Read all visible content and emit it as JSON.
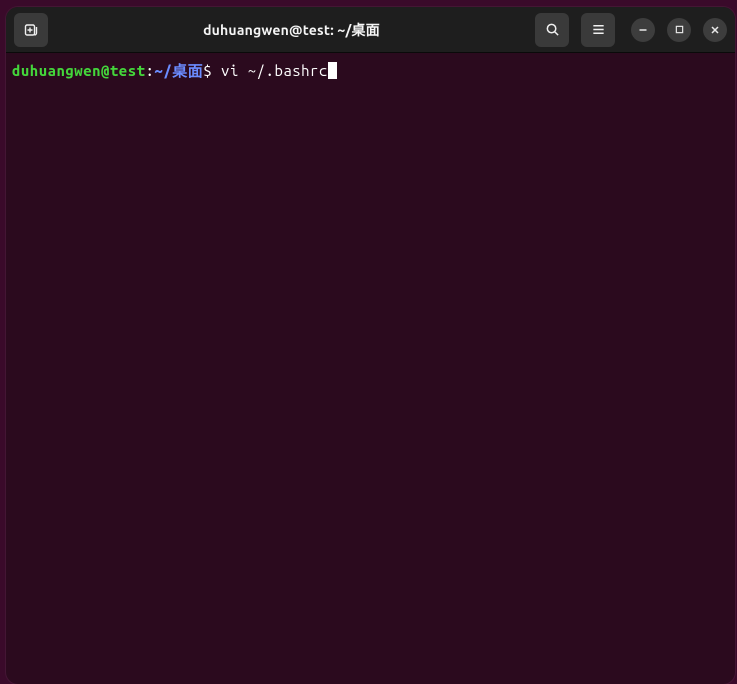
{
  "titlebar": {
    "title": "duhuangwen@test: ~/桌面"
  },
  "terminal": {
    "prompt": {
      "user_host": "duhuangwen@test",
      "colon": ":",
      "path": "~/桌面",
      "dollar": "$ "
    },
    "command": "vi ~/.bashrc"
  }
}
